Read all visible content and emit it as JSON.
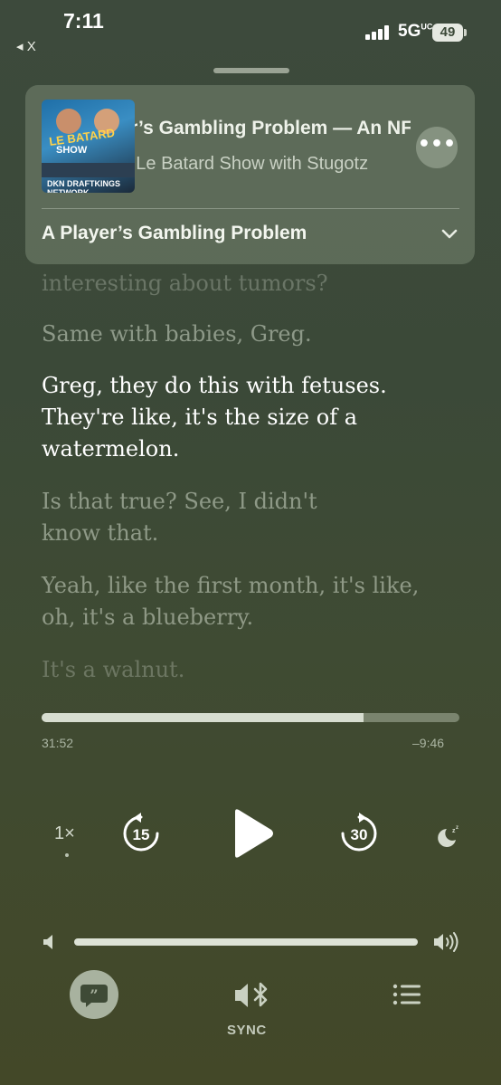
{
  "status_bar": {
    "time": "7:11",
    "back_label": "◂ X",
    "network": "5G",
    "network_suffix": "UC",
    "battery": "49"
  },
  "now_playing": {
    "episode_title": "A Player’s Gambling Problem — An NFL",
    "show_name": "The Dan Le Batard Show with Stugotz",
    "chapter_title": "A Player’s Gambling Problem",
    "artwork_lines": [
      "LE BATARD",
      "SHOW",
      "DKN DRAFTKINGS NETWORK"
    ]
  },
  "transcript": [
    {
      "text": "interesting about tumors?",
      "state": "faded-top"
    },
    {
      "text": "Same with babies, Greg.",
      "state": "past"
    },
    {
      "text": "Greg, they do this with fetuses. They're like, it's the size of a watermelon.",
      "state": "current"
    },
    {
      "text": "Is that true? See, I didn't know that.",
      "state": "upcoming"
    },
    {
      "text": "Yeah, like the first month, it's like, oh, it's a blueberry.",
      "state": "upcoming"
    },
    {
      "text": "It's a walnut.",
      "state": "faded-bottom"
    }
  ],
  "playback": {
    "elapsed": "31:52",
    "remaining": "–9:46",
    "progress": 0.77,
    "speed": "1×",
    "skip_back_seconds": "15",
    "skip_forward_seconds": "30",
    "volume": 1.0
  },
  "bottom_bar": {
    "sync_label": "SYNC"
  },
  "icons": [
    "more-icon",
    "chevron-down-icon",
    "skip-back-15-icon",
    "play-icon",
    "skip-forward-30-icon",
    "sleep-timer-icon",
    "volume-low-icon",
    "volume-high-icon",
    "lyrics-quote-icon",
    "airplay-bluetooth-icon",
    "queue-list-icon"
  ],
  "colors": {
    "background": "#3d4a3c",
    "text_active": "#ffffff",
    "accent_light": "#d7ddd0"
  }
}
